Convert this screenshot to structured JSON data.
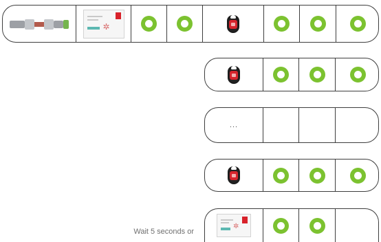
{
  "rows": [
    {
      "cells": [
        "cylinder-lock",
        "control-card",
        "green-ring",
        "green-ring",
        "key-fob",
        "green-ring",
        "green-ring",
        "green-ring"
      ]
    },
    {
      "cells": [
        "key-fob",
        "green-ring",
        "green-ring",
        "green-ring"
      ]
    },
    {
      "cells": [
        "ellipsis",
        "empty",
        "empty",
        "empty"
      ],
      "ellipsis_text": "..."
    },
    {
      "cells": [
        "key-fob",
        "green-ring",
        "green-ring",
        "green-ring"
      ]
    },
    {
      "cells": [
        "control-card",
        "green-ring",
        "green-ring",
        "empty"
      ]
    }
  ],
  "wait_note": "Wait 5 seconds or",
  "colors": {
    "border": "#3d3d3d",
    "ring": "#7cc230",
    "fob_face": "#d6242c",
    "card_logo": "#d8222a",
    "card_accent": "#5cb8b1"
  }
}
